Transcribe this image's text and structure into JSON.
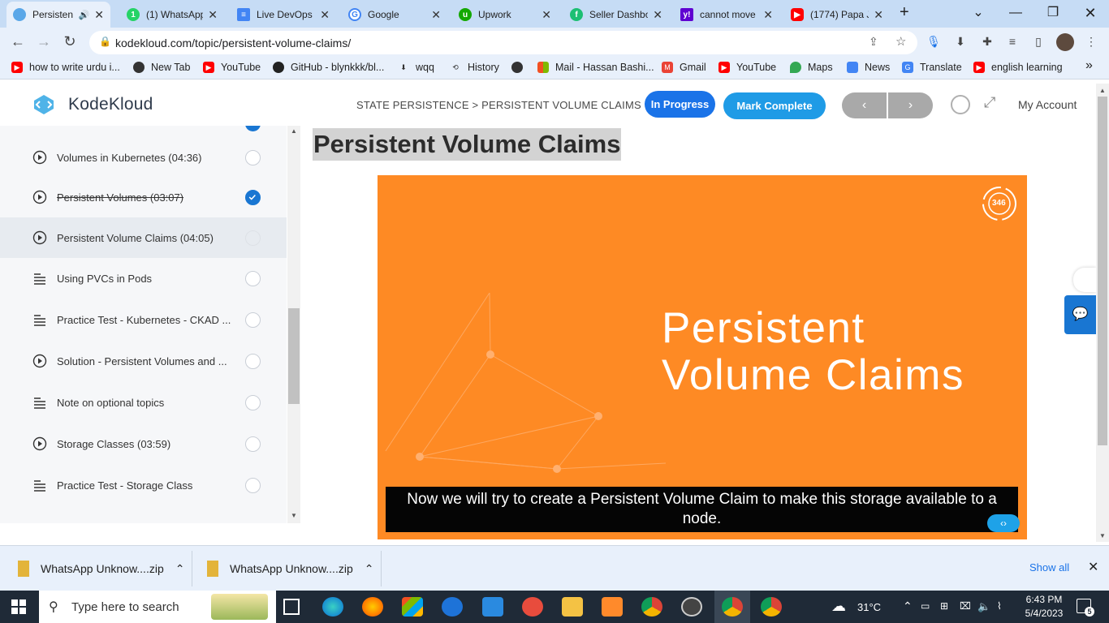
{
  "browser": {
    "tabs": [
      {
        "label": "Persisten",
        "favicon": "kodekloud-icon",
        "active": true
      },
      {
        "label": "(1) WhatsApp",
        "favicon": "whatsapp-icon"
      },
      {
        "label": "Live DevOps",
        "favicon": "docs-icon"
      },
      {
        "label": "Google",
        "favicon": "google-icon"
      },
      {
        "label": "Upwork",
        "favicon": "upwork-icon"
      },
      {
        "label": "Seller Dashbo",
        "favicon": "fiverr-icon"
      },
      {
        "label": "cannot move",
        "favicon": "yahoo-icon"
      },
      {
        "label": "(1774) Papa J",
        "favicon": "youtube-icon"
      }
    ],
    "new_tab": "+",
    "url": "kodekloud.com/topic/persistent-volume-claims/",
    "bookmarks": [
      "how to write urdu i...",
      "New Tab",
      "YouTube",
      "GitHub - blynkkk/bl...",
      "wqq",
      "History",
      "Mail - Hassan Bashi...",
      "Gmail",
      "YouTube",
      "Maps",
      "News",
      "Translate",
      "english learning"
    ],
    "bookmarks_more": "»"
  },
  "header": {
    "logo_text": "KodeKloud",
    "breadcrumb": "STATE PERSISTENCE > PERSISTENT VOLUME CLAIMS",
    "status_label": "In Progress",
    "mark_complete_label": "Mark Complete",
    "prev_label": "‹",
    "next_label": "›",
    "account_label": "My Account"
  },
  "sidebar": {
    "lessons": [
      {
        "title": "Volumes in Kubernetes (04:36)",
        "type": "video",
        "done": false
      },
      {
        "title": "Persistent Volumes (03:07)",
        "type": "video",
        "done": true
      },
      {
        "title": "Persistent Volume Claims (04:05)",
        "type": "video",
        "done": false,
        "current": true
      },
      {
        "title": "Using PVCs in Pods",
        "type": "text",
        "done": false
      },
      {
        "title": "Practice Test - Kubernetes - CKAD ...",
        "type": "text",
        "done": false
      },
      {
        "title": "Solution - Persistent Volumes and ...",
        "type": "video",
        "done": false
      },
      {
        "title": "Note on optional topics",
        "type": "text",
        "done": false
      },
      {
        "title": "Storage Classes (03:59)",
        "type": "video",
        "done": false
      },
      {
        "title": "Practice Test - Storage Class",
        "type": "text",
        "done": false
      }
    ]
  },
  "main": {
    "title": "Persistent Volume Claims",
    "video": {
      "slide_title_line1": "Persistent",
      "slide_title_line2": "Volume Claims",
      "badge": "346",
      "caption": "Now we will try to create a Persistent Volume Claim to make this storage available to a node."
    }
  },
  "downloads": {
    "items": [
      "WhatsApp Unknow....zip",
      "WhatsApp Unknow....zip"
    ],
    "show_all": "Show all"
  },
  "taskbar": {
    "search_placeholder": "Type here to search",
    "weather": "31°C",
    "time": "6:43 PM",
    "date": "5/4/2023",
    "notifications": "5"
  },
  "colors": {
    "accent_blue": "#1976d2",
    "video_orange": "#fe8a24",
    "tab_strip": "#c6dcf5"
  }
}
